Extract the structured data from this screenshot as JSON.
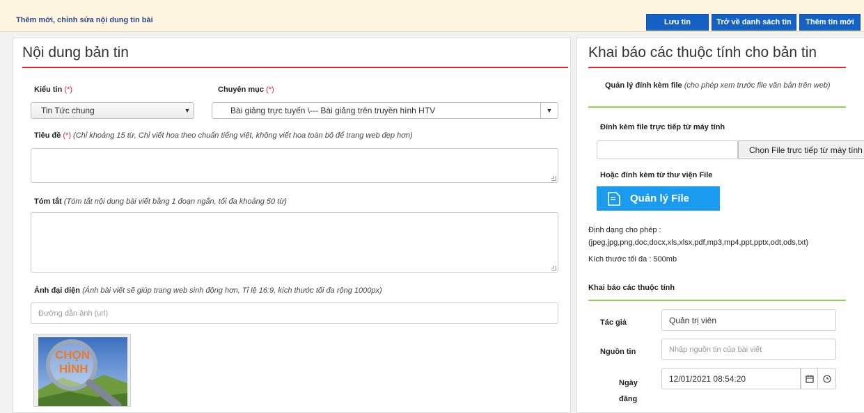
{
  "topbar": {
    "title": "Thêm mới, chỉnh sửa nội dung tin bài",
    "save_label": "Lưu tin",
    "back_label": "Trở về danh sách tin",
    "new_label": "Thêm tin mới"
  },
  "content": {
    "heading": "Nội dung bản tin",
    "news_type": {
      "label": "Kiểu tin",
      "required": "(*)",
      "value": "Tin Tức chung"
    },
    "category": {
      "label": "Chuyên mục",
      "required": "(*)",
      "value": "Bài giảng trực tuyến \\--- Bài giảng trên truyền hình HTV"
    },
    "title_field": {
      "label": "Tiêu đề",
      "required": "(*)",
      "hint": "(Chỉ khoảng 15 từ, Chỉ viết hoa theo chuẩn tiếng việt, không viết hoa toàn bộ để trang web đẹp hơn)"
    },
    "summary": {
      "label": "Tóm tắt",
      "hint": "(Tóm tắt nội dung bài viết bằng 1 đoạn ngắn, tối đa khoảng 50 từ)"
    },
    "avatar": {
      "label": "Ảnh đại diện",
      "hint": "(Ảnh bài viết sẽ giúp trang web sinh động hơn, Tỉ lệ 16:9, kích thước tối đa rộng 1000px)",
      "placeholder": "Đường dẫn ảnh (url)",
      "thumb_line1": "CHỌN",
      "thumb_line2": "HÌNH"
    }
  },
  "properties": {
    "heading": "Khai báo các thuộc tính cho bản tin",
    "attach": {
      "title": "Quản lý đính kèm file",
      "hint": "(cho phép xem trước file văn bản trên web)",
      "direct_label": "Đính kèm file trực tiếp từ máy tính",
      "choose_button": "Chọn File trực tiếp từ máy tính",
      "library_label": "Hoặc đính kèm từ thư viện File",
      "manager_button": "Quản lý File",
      "formats_label": "Định dạng cho phép :",
      "formats_value": "(jpeg,jpg,png,doc,docx,xls,xlsx,pdf,mp3,mp4,ppt,pptx,odt,ods,txt)",
      "max_size": "Kích thước tối đa : 500mb"
    },
    "attributes": {
      "title": "Khai báo các thuộc tính",
      "author_label": "Tác giả",
      "author_value": "Quản trị viên",
      "source_label": "Nguồn tin",
      "source_placeholder": "Nhập nguồn tin của bài viết",
      "date_label_1": "Ngày",
      "date_label_2": "đăng",
      "date_value": "12/01/2021 08:54:20"
    }
  },
  "colors": {
    "primary_button": "#1662c4",
    "file_manager_button": "#1b9bf0",
    "required": "#e0242b",
    "section_line_red": "#e0242b",
    "section_line_green": "#8fd14b"
  },
  "icons": [
    "calendar-icon",
    "clock-icon",
    "file-icon",
    "chevron-down-icon",
    "magnifier-icon"
  ]
}
